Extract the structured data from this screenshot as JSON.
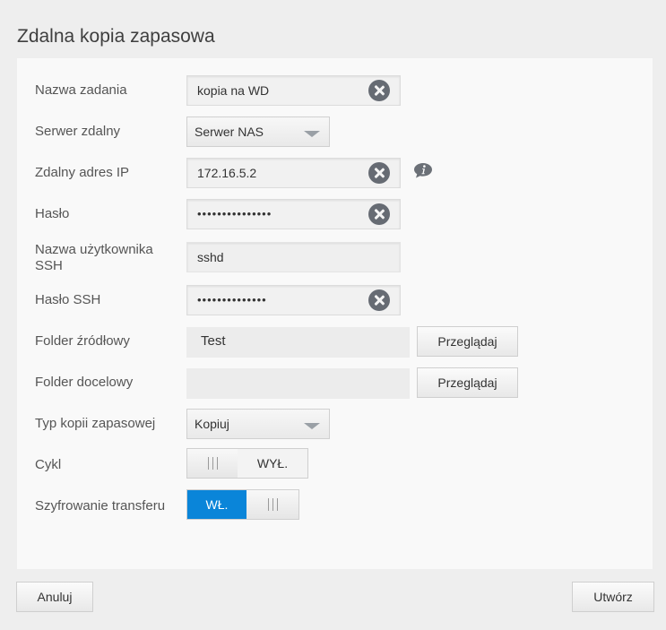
{
  "page": {
    "title": "Zdalna kopia zapasowa"
  },
  "form": {
    "job_name": {
      "label": "Nazwa zadania",
      "value": "kopia na WD"
    },
    "remote_server": {
      "label": "Serwer zdalny",
      "value": "Serwer NAS"
    },
    "remote_ip": {
      "label": "Zdalny adres IP",
      "value": "172.16.5.2"
    },
    "password": {
      "label": "Hasło",
      "value": "•••••••••••••••"
    },
    "ssh_user": {
      "label_line1": "Nazwa użytkownika",
      "label_line2": "SSH",
      "value": "sshd"
    },
    "ssh_password": {
      "label": "Hasło SSH",
      "value": "••••••••••••••"
    },
    "source_folder": {
      "label": "Folder źródłowy",
      "value": "Test",
      "browse_label": "Przeglądaj"
    },
    "target_folder": {
      "label": "Folder docelowy",
      "value": "",
      "browse_label": "Przeglądaj"
    },
    "backup_type": {
      "label": "Typ kopii zapasowej",
      "value": "Kopiuj"
    },
    "cycle": {
      "label": "Cykl",
      "state_label": "WYŁ."
    },
    "encryption": {
      "label": "Szyfrowanie transferu",
      "state_label": "WŁ."
    }
  },
  "footer": {
    "cancel_label": "Anuluj",
    "create_label": "Utwórz"
  },
  "colors": {
    "accent": "#0a85d9",
    "icon_gray": "#666b73"
  }
}
